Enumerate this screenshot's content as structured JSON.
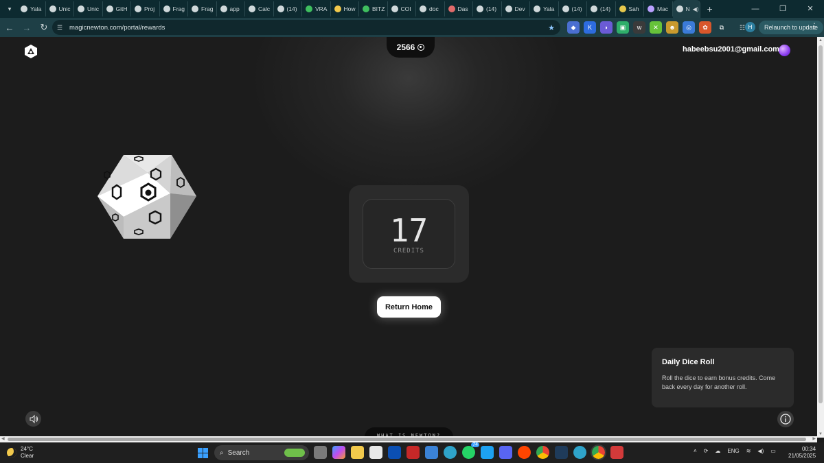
{
  "browser": {
    "tabs": [
      {
        "label": "Yala",
        "color": "#cfd8da"
      },
      {
        "label": "Unic",
        "color": "#cfd8da"
      },
      {
        "label": "Unic",
        "color": "#cfd8da"
      },
      {
        "label": "GitH",
        "color": "#cfd8da"
      },
      {
        "label": "Proj",
        "color": "#cfd8da"
      },
      {
        "label": "Frag",
        "color": "#cfd8da"
      },
      {
        "label": "Frag",
        "color": "#cfd8da"
      },
      {
        "label": "app",
        "color": "#cfd8da"
      },
      {
        "label": "Calc",
        "color": "#cfd8da"
      },
      {
        "label": "(14)",
        "color": "#cfd8da"
      },
      {
        "label": "VRA",
        "color": "#3fbf5f"
      },
      {
        "label": "How",
        "color": "#f2c94c"
      },
      {
        "label": "BITZ",
        "color": "#3fbf5f"
      },
      {
        "label": "COI",
        "color": "#cfd8da"
      },
      {
        "label": "doc",
        "color": "#cfd8da"
      },
      {
        "label": "Das",
        "color": "#e06a6a"
      },
      {
        "label": "(14)",
        "color": "#cfd8da"
      },
      {
        "label": "Dev",
        "color": "#cfd8da"
      },
      {
        "label": "Yala",
        "color": "#cfd8da"
      },
      {
        "label": "(14)",
        "color": "#cfd8da"
      },
      {
        "label": "(14)",
        "color": "#cfd8da"
      },
      {
        "label": "Sah",
        "color": "#e6c84c"
      },
      {
        "label": "Mac",
        "color": "#b9a0ff"
      }
    ],
    "active_tab_label": "N",
    "url": "magicnewton.com/portal/rewards",
    "relaunch_label": "Relaunch to update",
    "profile_initial": "H"
  },
  "page": {
    "credits_balance": "2566",
    "user_email": "habeebsu2001@gmail.com",
    "roll_result": "17",
    "roll_result_label": "CREDITS",
    "return_home_label": "Return Home",
    "info_title": "Daily Dice Roll",
    "info_text": "Roll the dice to earn bonus credits. Come back every day for another roll.",
    "footer_tab_label": "WHAT IS NEWTON?"
  },
  "taskbar": {
    "temperature": "24°C",
    "weather": "Clear",
    "search_label": "Search",
    "language": "ENG",
    "time": "00:34",
    "date": "21/05/2025",
    "badges": {
      "whatsapp": "74"
    }
  },
  "colors": {
    "page_bg": "#1c1c1c",
    "card_bg": "#2b2b2b",
    "browser_frame": "#0d2a30",
    "toolbar": "#1e3f46"
  }
}
